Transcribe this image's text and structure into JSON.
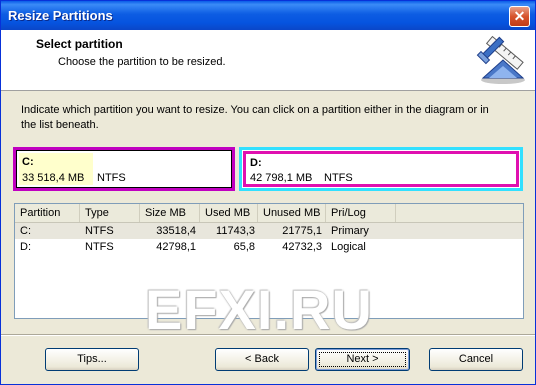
{
  "window": {
    "title": "Resize Partitions",
    "close_glyph": "✕"
  },
  "header": {
    "title": "Select partition",
    "subtitle": "Choose the partition to be resized.",
    "icon": "resize-tool-icon"
  },
  "instructions": "Indicate which partition you want to resize. You can click on a partition either in the diagram or in the list beneath.",
  "diagram": {
    "c": {
      "label": "C:",
      "size": "33 518,4 MB",
      "fs": "NTFS",
      "fill_fraction": 0.35
    },
    "d": {
      "label": "D:",
      "size": "42 798,1 MB",
      "fs": "NTFS"
    }
  },
  "table": {
    "columns": [
      "Partition",
      "Type",
      "Size MB",
      "Used MB",
      "Unused MB",
      "Pri/Log"
    ],
    "rows": [
      [
        "C:",
        "NTFS",
        "33518,4",
        "11743,3",
        "21775,1",
        "Primary"
      ],
      [
        "D:",
        "NTFS",
        "42798,1",
        "65,8",
        "42732,3",
        "Logical"
      ]
    ]
  },
  "watermark": "EFXI.RU",
  "buttons": {
    "tips": "Tips...",
    "back": "< Back",
    "next": "Next >",
    "cancel": "Cancel"
  },
  "colors": {
    "selected_border": "#c000c0",
    "highlight_border": "#32e0ff",
    "used_fill": "#ffffcc"
  }
}
